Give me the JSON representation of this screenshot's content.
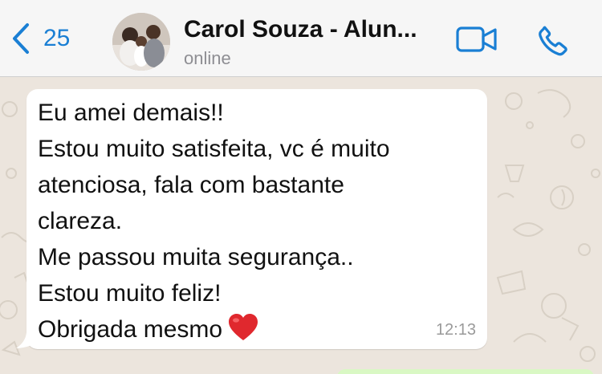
{
  "header": {
    "back_count": "25",
    "contact_name": "Carol Souza - Alun...",
    "status": "online",
    "icons": {
      "back": "chevron-left-icon",
      "video": "video-camera-icon",
      "call": "phone-icon"
    },
    "accent_color": "#1a7fd4"
  },
  "chat": {
    "background_color": "#ece5dd",
    "message": {
      "lines": [
        "Eu amei demais!!",
        "Estou muito satisfeita, vc é muito",
        "atenciosa, fala com bastante",
        "clareza.",
        "Me passou muita segurança..",
        "Estou muito feliz!",
        "Obrigada mesmo"
      ],
      "emoji": "red-heart-icon",
      "time": "12:13"
    }
  }
}
